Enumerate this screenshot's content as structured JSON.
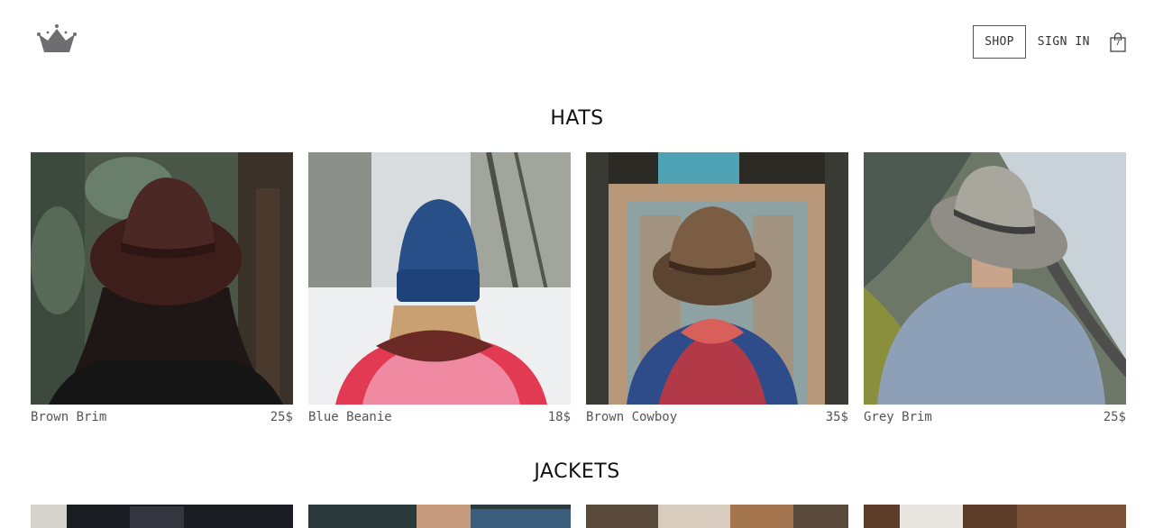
{
  "header": {
    "logo_icon": "crown-icon",
    "nav": {
      "shop_label": "SHOP",
      "signin_label": "SIGN IN"
    },
    "bag": {
      "icon": "shopping-bag-icon",
      "count": "7"
    }
  },
  "sections": {
    "hats": {
      "title": "HATS",
      "items": [
        {
          "name": "Brown Brim",
          "price": "25$"
        },
        {
          "name": "Blue Beanie",
          "price": "18$"
        },
        {
          "name": "Brown Cowboy",
          "price": "35$"
        },
        {
          "name": "Grey Brim",
          "price": "25$"
        }
      ]
    },
    "jackets": {
      "title": "JACKETS"
    }
  },
  "colors": {
    "text": "#202020",
    "muted": "#555555",
    "border": "#555555"
  }
}
